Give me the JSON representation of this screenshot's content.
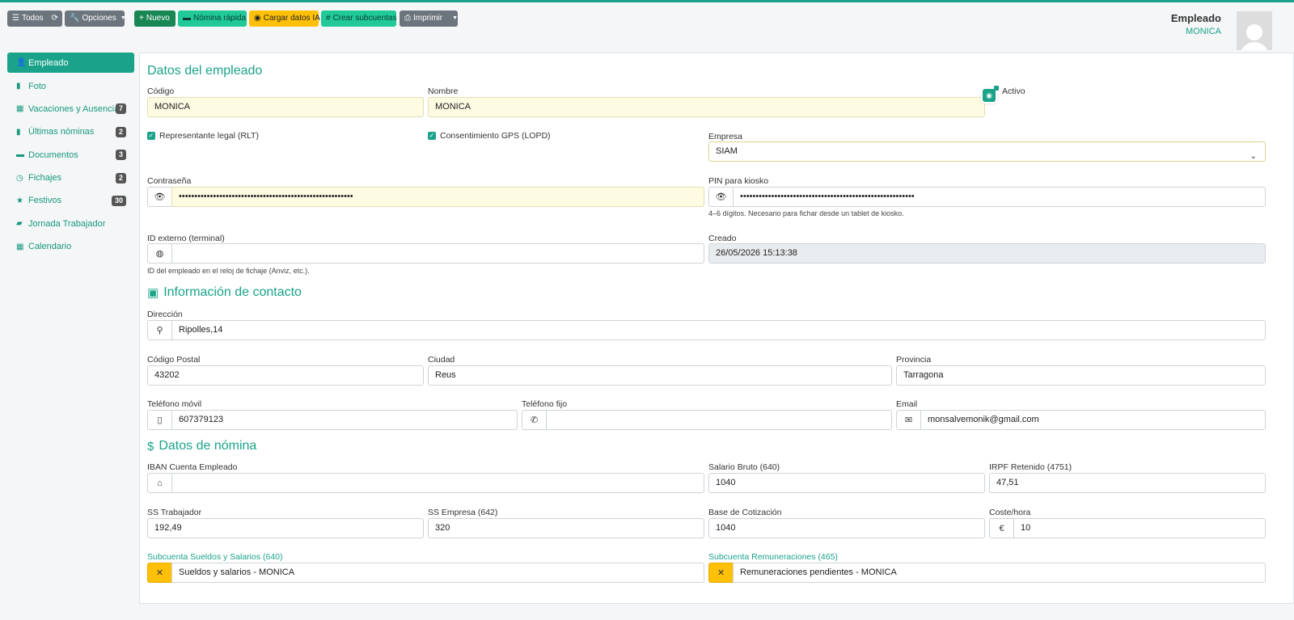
{
  "toolbar": {
    "todos": "Todos",
    "refresh_icon": "refresh-icon",
    "opciones": "Opciones",
    "nuevo": "Nuevo",
    "nomina_rapida": "Nómina rápida",
    "cargar_ia": "Cargar datos IA",
    "crear_subcuentas": "Crear subcuentas",
    "imprimir": "Imprimir"
  },
  "header": {
    "title": "Empleado",
    "subtitle": "MONICA"
  },
  "sidebar": {
    "items": [
      {
        "label": "Empleado",
        "icon": "user-gear-icon"
      },
      {
        "label": "Foto",
        "icon": "file-icon"
      },
      {
        "label": "Vacaciones y Ausencias",
        "badge": "7",
        "icon": "calendar-icon"
      },
      {
        "label": "Últimas nóminas",
        "badge": "2",
        "icon": "file-icon"
      },
      {
        "label": "Documentos",
        "badge": "3",
        "icon": "folder-icon"
      },
      {
        "label": "Fichajes",
        "badge": "2",
        "icon": "clock-icon"
      },
      {
        "label": "Festivos",
        "badge": "30",
        "icon": "star-icon"
      },
      {
        "label": "Jornada Trabajador",
        "icon": "briefcase-icon"
      },
      {
        "label": "Calendario",
        "icon": "calendar-icon"
      }
    ]
  },
  "datos": {
    "title": "Datos del empleado",
    "codigo_label": "Código",
    "codigo": "MONICA",
    "nombre_label": "Nombre",
    "nombre": "MONICA",
    "activo": "Activo",
    "rlt": "Representante legal (RLT)",
    "gps": "Consentimiento GPS (LOPD)",
    "empresa_label": "Empresa",
    "empresa": "SIAM",
    "password_label": "Contraseña",
    "password": "••••••••••••••••••••••••••••••••••••••••••••••••••••••••",
    "pin_label": "PIN para kiosko",
    "pin": "••••••••••••••••••••••••••••••••••••••••••••••••••••••••",
    "pin_help": "4–6 dígitos. Necesario para fichar desde un tablet de kiosko.",
    "idext_label": "ID externo (terminal)",
    "idext": "",
    "idext_help": "ID del empleado en el reloj de fichaje (Anviz, etc.).",
    "creado_label": "Creado",
    "creado": "26/05/2026 15:13:38"
  },
  "contacto": {
    "title": "Información de contacto",
    "direccion_label": "Dirección",
    "direccion": "Ripolles,14",
    "cp_label": "Código Postal",
    "cp": "43202",
    "ciudad_label": "Ciudad",
    "ciudad": "Reus",
    "provincia_label": "Provincia",
    "provincia": "Tarragona",
    "movil_label": "Teléfono móvil",
    "movil": "607379123",
    "fijo_label": "Teléfono fijo",
    "fijo": "",
    "email_label": "Email",
    "email": "monsalvemonik@gmail.com"
  },
  "nomina": {
    "title": "Datos de nómina",
    "iban_label": "IBAN Cuenta Empleado",
    "iban": "",
    "bruto_label": "Salario Bruto (640)",
    "bruto": "1040",
    "irpf_label": "IRPF Retenido (4751)",
    "irpf": "47,51",
    "sst_label": "SS Trabajador",
    "sst": "192,49",
    "sse_label": "SS Empresa (642)",
    "sse": "320",
    "base_label": "Base de Cotización",
    "base": "1040",
    "coste_label": "Coste/hora",
    "coste": "10",
    "coste_unit": "€",
    "sub_sueldos_label": "Subcuenta Sueldos y Salarios (640)",
    "sub_sueldos": "Sueldos y salarios - MONICA",
    "sub_remun_label": "Subcuenta Remuneraciones (465)",
    "sub_remun": "Remuneraciones pendientes - MONICA"
  },
  "colors": {
    "accent": "#1aa38a",
    "input_highlight": "#fefbe3",
    "warning": "#ffc107"
  }
}
